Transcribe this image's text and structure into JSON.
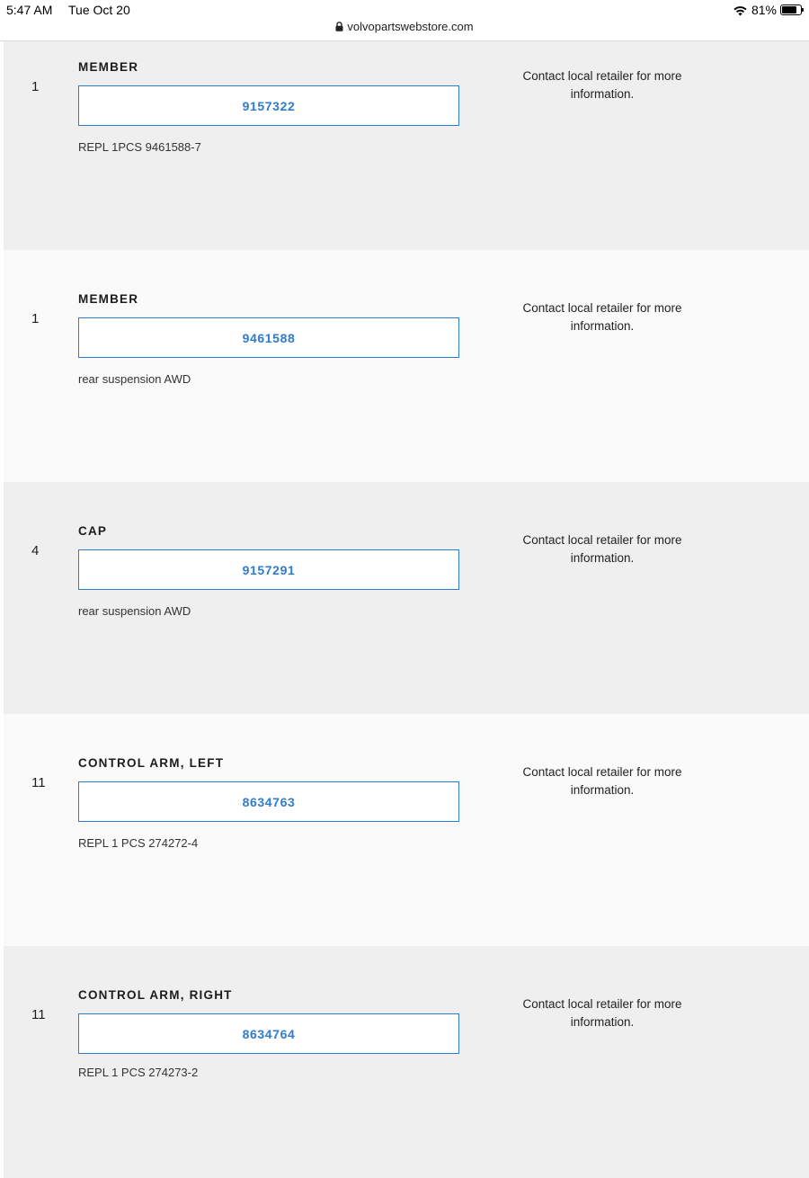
{
  "status_bar": {
    "time": "5:47 AM",
    "date": "Tue Oct 20",
    "battery": "81%",
    "battery_level": 0.81
  },
  "browser": {
    "url": "volvopartswebstore.com"
  },
  "parts": [
    {
      "qty": "1",
      "name": "MEMBER",
      "part_number": "9157322",
      "note": "REPL 1PCS 9461588-7",
      "availability": "Contact local retailer for more information."
    },
    {
      "qty": "1",
      "name": "MEMBER",
      "part_number": "9461588",
      "note": "rear suspension AWD",
      "availability": "Contact local retailer for more information."
    },
    {
      "qty": "4",
      "name": "CAP",
      "part_number": "9157291",
      "note": "rear suspension AWD",
      "availability": "Contact local retailer for more information."
    },
    {
      "qty": "11",
      "name": "CONTROL ARM, LEFT",
      "part_number": "8634763",
      "note": "REPL 1 PCS 274272-4",
      "availability": "Contact local retailer for more information."
    },
    {
      "qty": "11",
      "name": "CONTROL ARM, RIGHT",
      "part_number": "8634764",
      "note": "REPL 1 PCS 274273-2",
      "availability": "Contact local retailer for more information."
    }
  ]
}
